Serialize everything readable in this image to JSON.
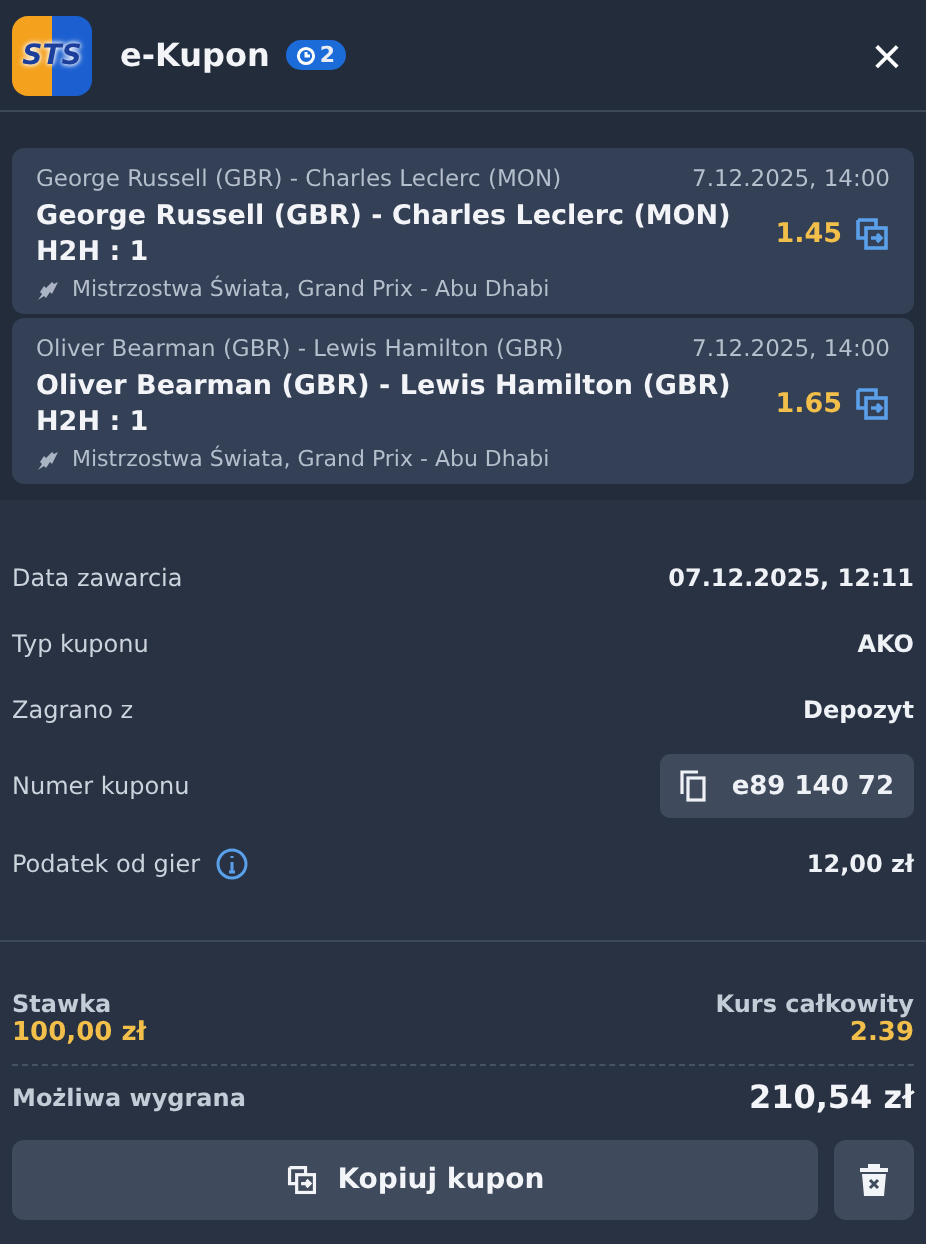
{
  "header": {
    "logo": "STS",
    "title": "e-Kupon",
    "badge": "2",
    "close": "×"
  },
  "selections": [
    {
      "event": "George Russell (GBR) - Charles Leclerc (MON)",
      "date": "7.12.2025, 14:00",
      "pick": "George Russell (GBR) - Charles Leclerc (MON) H2H : 1",
      "odds": "1.45",
      "league": "Mistrzostwa Świata, Grand Prix - Abu Dhabi"
    },
    {
      "event": "Oliver Bearman (GBR) - Lewis Hamilton (GBR)",
      "date": "7.12.2025, 14:00",
      "pick": "Oliver Bearman (GBR) - Lewis Hamilton (GBR) H2H : 1",
      "odds": "1.65",
      "league": "Mistrzostwa Świata, Grand Prix - Abu Dhabi"
    }
  ],
  "details": [
    {
      "kind": "text",
      "label": "Data zawarcia",
      "value": "07.12.2025, 12:11"
    },
    {
      "kind": "text",
      "label": "Typ kuponu",
      "value": "AKO"
    },
    {
      "kind": "text",
      "label": "Zagrano z",
      "value": "Depozyt"
    },
    {
      "kind": "copy",
      "label": "Numer kuponu",
      "value": "e89 140 72"
    },
    {
      "kind": "info",
      "label": "Podatek od gier",
      "value": "12,00 zł"
    }
  ],
  "summary": {
    "stake_label": "Stawka",
    "stake": "100,00 zł",
    "odds_label": "Kurs całkowity",
    "odds": "2.39",
    "win_label": "Możliwa wygrana",
    "win": "210,54 zł"
  },
  "actions": {
    "copy_button": "Kopiuj kupon"
  }
}
